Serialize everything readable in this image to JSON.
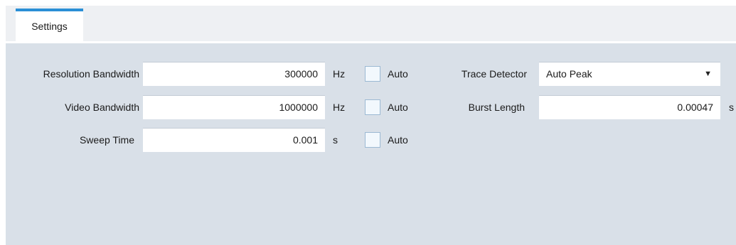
{
  "tabs": [
    {
      "label": "Settings",
      "active": true
    }
  ],
  "settings": {
    "rbw": {
      "label": "Resolution Bandwidth",
      "value": "300000",
      "unit": "Hz",
      "auto_label": "Auto",
      "auto_checked": false
    },
    "vbw": {
      "label": "Video Bandwidth",
      "value": "1000000",
      "unit": "Hz",
      "auto_label": "Auto",
      "auto_checked": false
    },
    "sweep": {
      "label": "Sweep Time",
      "value": "0.001",
      "unit": "s",
      "auto_label": "Auto",
      "auto_checked": false
    },
    "detector": {
      "label": "Trace Detector",
      "value": "Auto Peak",
      "icon": "triangle-down-icon"
    },
    "burst": {
      "label": "Burst Length",
      "value": "0.00047",
      "unit": "s"
    }
  },
  "colors": {
    "tab_accent": "#2a8fd6",
    "panel_bg": "#d9e0e8",
    "tabbar_bg": "#eef0f3",
    "field_bg": "#ffffff"
  }
}
